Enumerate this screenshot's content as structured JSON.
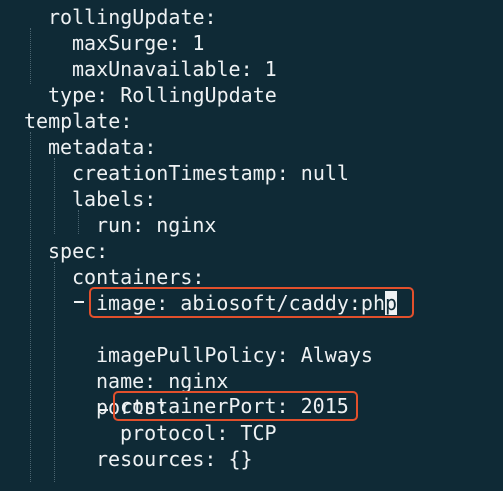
{
  "editor": {
    "colors": {
      "background": "#0f2a36",
      "text": "#eef1f3",
      "highlight_border": "#e2502c"
    },
    "lines": [
      {
        "text": "rollingUpdate:"
      },
      {
        "text": "maxSurge: 1"
      },
      {
        "text": "maxUnavailable: 1"
      },
      {
        "text": "type: RollingUpdate"
      },
      {
        "text": "template:"
      },
      {
        "text": "metadata:"
      },
      {
        "text": "creationTimestamp: null"
      },
      {
        "text": "labels:"
      },
      {
        "text": "run: nginx"
      },
      {
        "text": "spec:"
      },
      {
        "text": "containers:"
      },
      {
        "text_before_cursor": "image: abiosoft/caddy:ph",
        "cursor_char": "p"
      },
      {
        "text": "imagePullPolicy: Always"
      },
      {
        "text": "name: nginx"
      },
      {
        "text": "ports:"
      },
      {
        "text": "containerPort: 2015"
      },
      {
        "text": "protocol: TCP"
      },
      {
        "text": "resources: {}"
      }
    ]
  }
}
